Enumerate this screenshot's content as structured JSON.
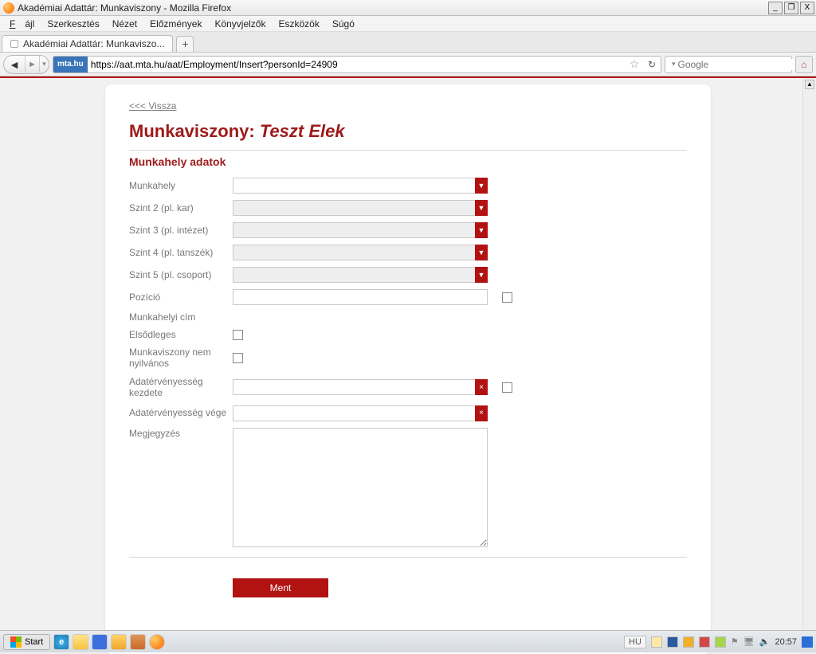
{
  "window": {
    "title": "Akadémiai Adattár: Munkaviszony - Mozilla Firefox"
  },
  "menu": {
    "fajl": "Fájl",
    "szerkesztes": "Szerkesztés",
    "nezet": "Nézet",
    "elozmenyek": "Előzmények",
    "konyvjelzok": "Könyvjelzők",
    "eszkozok": "Eszközök",
    "sugo": "Súgó"
  },
  "tab": {
    "title": "Akadémiai Adattár: Munkaviszo..."
  },
  "url": {
    "host": "mta.hu",
    "full": "https://aat.mta.hu/aat/Employment/Insert?personId=24909"
  },
  "search": {
    "placeholder": "Google"
  },
  "page": {
    "back_link": "<<< Vissza",
    "title_prefix": "Munkaviszony: ",
    "title_name": "Teszt Elek",
    "section": "Munkahely adatok",
    "labels": {
      "munkahely": "Munkahely",
      "szint2": "Szint 2 (pl. kar)",
      "szint3": "Szint 3 (pl. intézet)",
      "szint4": "Szint 4 (pl. tanszék)",
      "szint5": "Szint 5 (pl. csoport)",
      "pozicio": "Pozíció",
      "munkahelyi_cim": "Munkahelyi cím",
      "elsodleges": "Elsődleges",
      "nem_nyilvanos": "Munkaviszony nem nyilvános",
      "erv_kezdete": "Adatérvényesség kezdete",
      "erv_vege": "Adatérvényesség vége",
      "megjegyzes": "Megjegyzés"
    },
    "save": "Ment"
  },
  "taskbar": {
    "start": "Start",
    "lang": "HU",
    "clock": "20:57"
  }
}
